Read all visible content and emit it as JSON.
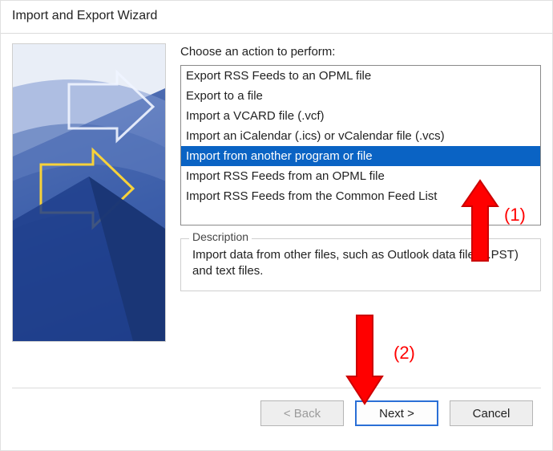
{
  "window": {
    "title": "Import and Export Wizard"
  },
  "prompt": "Choose an action to perform:",
  "actions": {
    "items": [
      "Export RSS Feeds to an OPML file",
      "Export to a file",
      "Import a VCARD file (.vcf)",
      "Import an iCalendar (.ics) or vCalendar file (.vcs)",
      "Import from another program or file",
      "Import RSS Feeds from an OPML file",
      "Import RSS Feeds from the Common Feed List"
    ],
    "selected_index": 4
  },
  "description": {
    "legend": "Description",
    "text": "Import data from other files, such as Outlook data files (.PST) and text files."
  },
  "buttons": {
    "back": "< Back",
    "next": "Next >",
    "cancel": "Cancel"
  },
  "annotations": {
    "label1": "(1)",
    "label2": "(2)"
  }
}
